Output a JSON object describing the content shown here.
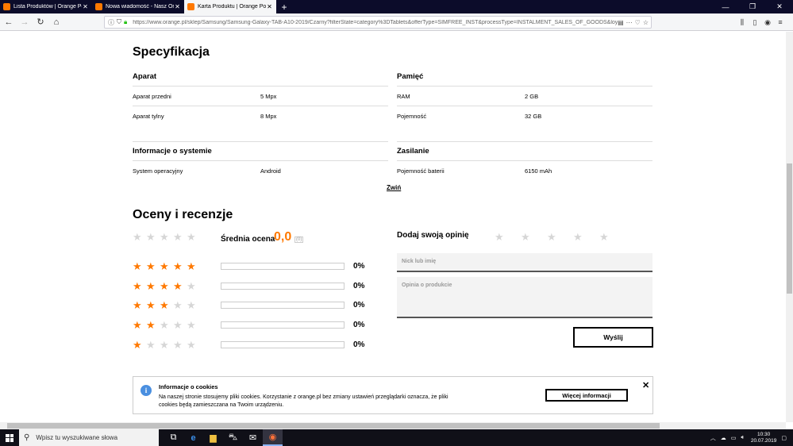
{
  "browser": {
    "tabs": [
      {
        "title": "Lista Produktów | Orange Polska",
        "favicon_color": "#ff7900",
        "active": false
      },
      {
        "title": "Nowa wiadomość - Nasz Orange",
        "favicon_color": "#ff7900",
        "active": false
      },
      {
        "title": "Karta Produktu | Orange Polska",
        "favicon_color": "#ff7900",
        "active": true
      }
    ],
    "new_tab": "+",
    "url": "https://www.orange.pl/sklep/Samsung/Samsung-Galaxy-TAB-A10-2019/Czarny?filterState=category%3DTablets&offerType=SIMFREE_INST&processType=INSTALMENT_SALES_OF_GOODS&loya..."
  },
  "spec": {
    "title": "Specyfikacja",
    "groups": [
      {
        "name": "Aparat",
        "rows": [
          {
            "k": "Aparat przedni",
            "v": "5 Mpx"
          },
          {
            "k": "Aparat tylny",
            "v": "8 Mpx"
          }
        ]
      },
      {
        "name": "Pamięć",
        "rows": [
          {
            "k": "RAM",
            "v": "2 GB"
          },
          {
            "k": "Pojemność",
            "v": "32 GB"
          }
        ]
      },
      {
        "name": "Informacje o systemie",
        "rows": [
          {
            "k": "System operacyjny",
            "v": "Android"
          }
        ]
      },
      {
        "name": "Zasilanie",
        "rows": [
          {
            "k": "Pojemność baterii",
            "v": "6150 mAh"
          }
        ]
      }
    ],
    "collapse_label": "Zwiń"
  },
  "reviews": {
    "title": "Oceny i recenzje",
    "avg_label": "Średnia ocena",
    "avg_value": "0,0",
    "avg_count": "(0)",
    "rows": [
      {
        "stars": 5,
        "share": 0,
        "pct": "0%"
      },
      {
        "stars": 4,
        "share": 0,
        "pct": "0%"
      },
      {
        "stars": 3,
        "share": 0,
        "pct": "0%"
      },
      {
        "stars": 2,
        "share": 0,
        "pct": "0%"
      },
      {
        "stars": 1,
        "share": 0,
        "pct": "0%"
      }
    ],
    "add_label": "Dodaj swoją opinię",
    "nick_placeholder": "Nick lub imię",
    "opinion_placeholder": "Opinia o produkcie",
    "submit_label": "Wyślij",
    "accent": "#ff7900"
  },
  "cookie": {
    "title": "Informacje o cookies",
    "text": "Na naszej stronie stosujemy pliki cookies. Korzystanie z orange.pl bez zmiany ustawień przeglądarki oznacza, że pliki cookies będą zamieszczana na Twoim urządzeniu.",
    "more_label": "Więcej informacji",
    "close_glyph": "✕",
    "info_glyph": "i"
  },
  "taskbar": {
    "search_placeholder": "Wpisz tu wyszukiwane słowa",
    "time": "10:30",
    "date": "20.07.2019"
  }
}
